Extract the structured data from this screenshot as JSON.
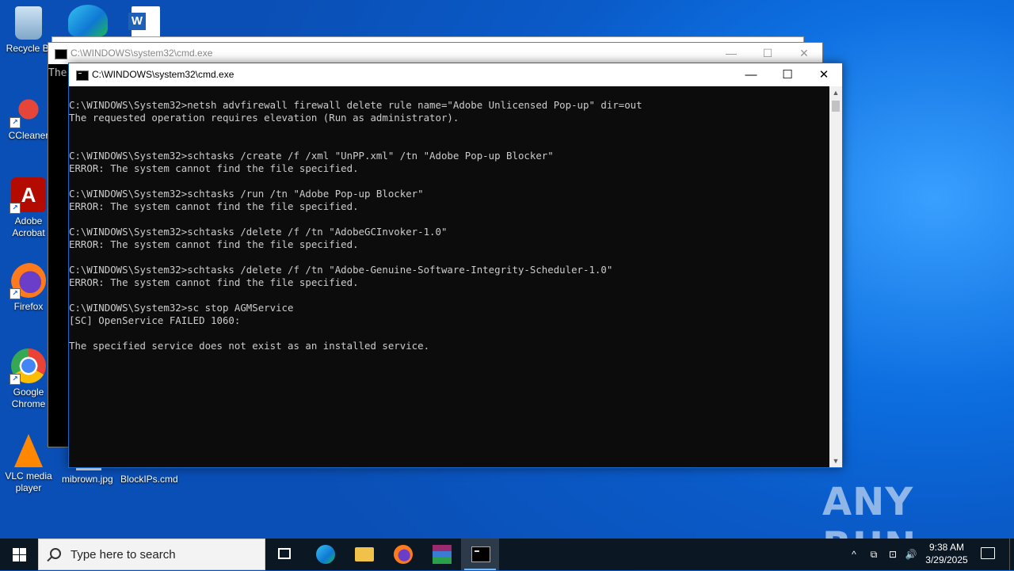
{
  "desktop": {
    "icons": [
      {
        "label": "Recycle Bin",
        "shown": "Recycle Bi"
      },
      {
        "label": "CCleaner"
      },
      {
        "label": "Adobe Acrobat",
        "line1": "Adobe",
        "line2": "Acrobat"
      },
      {
        "label": "Firefox"
      },
      {
        "label": "Google Chrome",
        "line1": "Google",
        "line2": "Chrome"
      },
      {
        "label": "VLC media player",
        "line1": "VLC media",
        "line2": "player"
      }
    ],
    "files": {
      "jpg": "mibrown.jpg",
      "cmd": "BlockIPs.cmd"
    }
  },
  "back_window": {
    "title": "C:\\WINDOWS\\system32\\cmd.exe",
    "peek_text": "The",
    "minimize": "—",
    "maximize": "☐",
    "close": "✕"
  },
  "window": {
    "title": "C:\\WINDOWS\\system32\\cmd.exe",
    "minimize": "—",
    "maximize": "☐",
    "close": "✕",
    "lines": [
      "C:\\WINDOWS\\System32>netsh advfirewall firewall delete rule name=\"Adobe Unlicensed Pop-up\" dir=out",
      "The requested operation requires elevation (Run as administrator).",
      "",
      "",
      "C:\\WINDOWS\\System32>schtasks /create /f /xml \"UnPP.xml\" /tn \"Adobe Pop-up Blocker\"",
      "ERROR: The system cannot find the file specified.",
      "",
      "C:\\WINDOWS\\System32>schtasks /run /tn \"Adobe Pop-up Blocker\"",
      "ERROR: The system cannot find the file specified.",
      "",
      "C:\\WINDOWS\\System32>schtasks /delete /f /tn \"AdobeGCInvoker-1.0\"",
      "ERROR: The system cannot find the file specified.",
      "",
      "C:\\WINDOWS\\System32>schtasks /delete /f /tn \"Adobe-Genuine-Software-Integrity-Scheduler-1.0\"",
      "ERROR: The system cannot find the file specified.",
      "",
      "C:\\WINDOWS\\System32>sc stop AGMService",
      "[SC] OpenService FAILED 1060:",
      "",
      "The specified service does not exist as an installed service."
    ]
  },
  "watermark": "ANY RUN",
  "taskbar": {
    "search_placeholder": "Type here to search",
    "time": "9:38 AM",
    "date": "3/29/2025",
    "tray_chevron": "^",
    "volume": "🔊"
  }
}
